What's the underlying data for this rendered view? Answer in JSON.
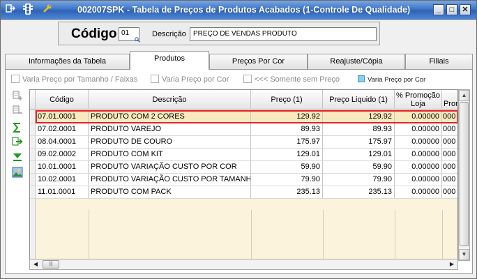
{
  "window": {
    "title": "002007SPK - Tabela de Preços de Produtos Acabados (1-Controle De Qualidade)",
    "buttons": {
      "minimize": "_",
      "maximize": "□",
      "close": "✕"
    }
  },
  "header": {
    "code_label": "Código",
    "code_value": "01",
    "desc_label": "Descrição",
    "desc_value": "PREÇO DE VENDAS PRODUTO"
  },
  "tabs": [
    {
      "label": "Informações da Tabela",
      "active": false
    },
    {
      "label": "Produtos",
      "active": true
    },
    {
      "label": "Preços Por Cor",
      "active": false
    },
    {
      "label": "Reajuste/Cópia",
      "active": false
    },
    {
      "label": "Filiais",
      "active": false
    }
  ],
  "options": {
    "varia_tamanho": "Varia Preço por Tamanho / Faixas",
    "varia_cor": "Varia Preço por Cor",
    "somente_sem_preco": "<<< Somente sem Preço",
    "legend_varia_cor": "Varia Preço por Cor"
  },
  "table": {
    "columns": [
      "Código",
      "Descrição",
      "Preço (1)",
      "Preço Liquido (1)",
      "% Promoção Loja",
      "% Promoção"
    ],
    "rows": [
      {
        "codigo": "07.01.0001",
        "descricao": "PRODUTO COM 2 CORES",
        "preco": "129.92",
        "liquido": "129.92",
        "promo": "0.00000",
        "promo2": "000"
      },
      {
        "codigo": "07.02.0001",
        "descricao": "PRODUTO VAREJO",
        "preco": "89.93",
        "liquido": "89.93",
        "promo": "0.00000",
        "promo2": "000"
      },
      {
        "codigo": "08.04.0001",
        "descricao": "PRODUTO DE COURO",
        "preco": "175.97",
        "liquido": "175.97",
        "promo": "0.00000",
        "promo2": "000"
      },
      {
        "codigo": "09.02.0002",
        "descricao": "PRODUTO COM KIT",
        "preco": "129.01",
        "liquido": "129.01",
        "promo": "0.00000",
        "promo2": "000"
      },
      {
        "codigo": "10.01.0001",
        "descricao": "PRODUTO VARIAÇÃO CUSTO POR COR",
        "preco": "59.90",
        "liquido": "59.90",
        "promo": "0.00000",
        "promo2": "000"
      },
      {
        "codigo": "10.02.0001",
        "descricao": "PRODUTO VARIAÇÃO CUSTO POR TAMANHO",
        "preco": "79.90",
        "liquido": "79.90",
        "promo": "0.00000",
        "promo2": "000"
      },
      {
        "codigo": "11.01.0001",
        "descricao": "PRODUTO COM PACK",
        "preco": "235.13",
        "liquido": "235.13",
        "promo": "0.00000",
        "promo2": "000"
      }
    ]
  },
  "scrollbar": {
    "h_thumb_grip": "|||"
  },
  "colors": {
    "titlebar": "#3f76c9",
    "selection_border": "#e8202a",
    "selected_row": "#f8e9bf",
    "grid_empty": "#fbf3dc",
    "legend_swatch": "#7fd6f0"
  }
}
